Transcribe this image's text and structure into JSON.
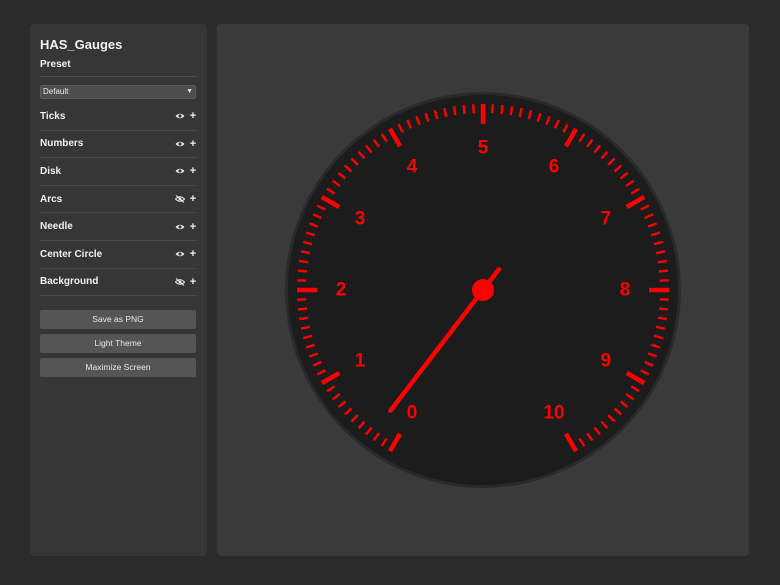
{
  "sidebar": {
    "title": "HAS_Gauges",
    "preset_label": "Preset",
    "preset_value": "Default",
    "sections": [
      {
        "label": "Ticks",
        "visible": true
      },
      {
        "label": "Numbers",
        "visible": true
      },
      {
        "label": "Disk",
        "visible": true
      },
      {
        "label": "Arcs",
        "visible": false
      },
      {
        "label": "Needle",
        "visible": true
      },
      {
        "label": "Center Circle",
        "visible": true
      },
      {
        "label": "Background",
        "visible": false
      }
    ],
    "plus_glyph": "+",
    "buttons": {
      "save_png": "Save as PNG",
      "light_theme": "Light Theme",
      "maximize": "Maximize Screen"
    }
  },
  "gauge": {
    "numbers": [
      "0",
      "1",
      "2",
      "3",
      "4",
      "5",
      "6",
      "7",
      "8",
      "9",
      "10"
    ],
    "min": 0,
    "max": 10,
    "needle_value": 0.25,
    "colors": {
      "accent": "#ff0000",
      "disk": "#1c1c1c",
      "rim": "#2a2a2a",
      "main_bg": "#3a3a3a"
    }
  }
}
